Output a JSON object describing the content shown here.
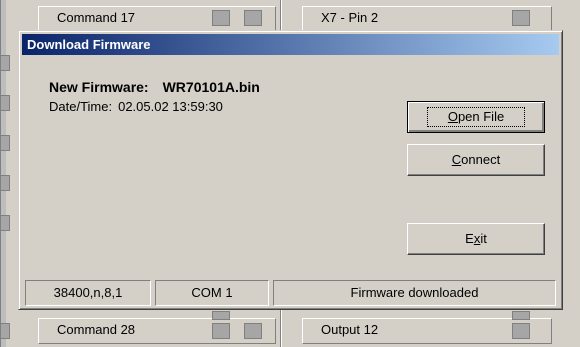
{
  "background": {
    "top_left_label": "Command 17",
    "top_right_label": "X7 - Pin 2",
    "bottom_left_label": "Command 28",
    "bottom_right_label": "Output 12"
  },
  "dialog": {
    "title": "Download Firmware",
    "new_firmware_label": "New Firmware:",
    "new_firmware_value": "WR70101A.bin",
    "datetime_label": "Date/Time:",
    "datetime_value": "02.05.02 13:59:30",
    "buttons": {
      "open_file": {
        "hotkey": "O",
        "rest": "pen File"
      },
      "connect": {
        "hotkey": "C",
        "rest": "onnect"
      },
      "exit": {
        "pre": "E",
        "hotkey": "x",
        "rest": "it"
      }
    },
    "status": {
      "port_settings": "38400,n,8,1",
      "port": "COM 1",
      "message": "Firmware downloaded"
    }
  },
  "colors": {
    "title_start": "#0a246a",
    "title_end": "#a6caf0",
    "face": "#d4d0c8"
  }
}
